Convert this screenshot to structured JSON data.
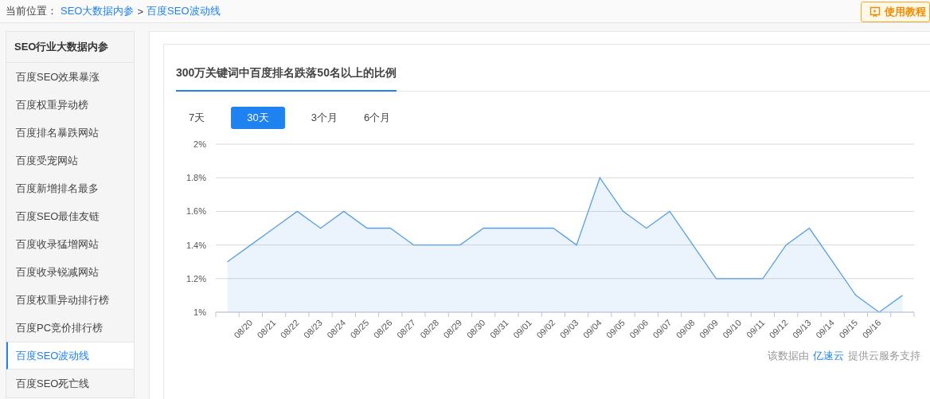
{
  "breadcrumb": {
    "label": "当前位置：",
    "links": [
      "SEO大数据内参",
      "百度SEO波动线"
    ],
    "separator": ">"
  },
  "help_button": {
    "label": "使用教程"
  },
  "sidebar": {
    "title": "SEO行业大数据内参",
    "items": [
      {
        "label": "百度SEO效果暴涨",
        "selected": false
      },
      {
        "label": "百度权重异动榜",
        "selected": false
      },
      {
        "label": "百度排名暴跌网站",
        "selected": false
      },
      {
        "label": "百度受宠网站",
        "selected": false
      },
      {
        "label": "百度新增排名最多",
        "selected": false
      },
      {
        "label": "百度SEO最佳友链",
        "selected": false
      },
      {
        "label": "百度收录猛增网站",
        "selected": false
      },
      {
        "label": "百度收录锐减网站",
        "selected": false
      },
      {
        "label": "百度权重异动排行榜",
        "selected": false
      },
      {
        "label": "百度PC竞价排行榜",
        "selected": false
      },
      {
        "label": "百度SEO波动线",
        "selected": true
      },
      {
        "label": "百度SEO死亡线",
        "selected": false
      }
    ]
  },
  "panel": {
    "title": "300万关键词中百度排名跌落50名以上的比例",
    "ranges": [
      {
        "label": "7天",
        "selected": false
      },
      {
        "label": "30天",
        "selected": true
      },
      {
        "label": "3个月",
        "selected": false
      },
      {
        "label": "6个月",
        "selected": false
      }
    ],
    "chart_data": {
      "type": "area",
      "categories": [
        null,
        "08/20",
        "08/21",
        "08/22",
        "08/23",
        "08/24",
        "08/25",
        "08/26",
        "08/27",
        "08/28",
        "08/29",
        "08/30",
        "08/31",
        "09/01",
        "09/02",
        "09/03",
        "09/04",
        "09/05",
        "09/06",
        "09/07",
        "09/08",
        "09/09",
        "09/10",
        "09/11",
        "09/12",
        "09/13",
        "09/14",
        "09/15",
        "09/16",
        null
      ],
      "series": [
        {
          "color": "#5a9fe6",
          "values": [
            1.3,
            1.4,
            1.5,
            1.6,
            1.5,
            1.6,
            1.5,
            1.5,
            1.4,
            1.4,
            1.4,
            1.5,
            1.5,
            1.5,
            1.5,
            1.4,
            1.8,
            1.6,
            1.5,
            1.6,
            1.4,
            1.2,
            1.2,
            1.2,
            1.4,
            1.5,
            1.3,
            1.1,
            1.0,
            1.1
          ]
        }
      ],
      "ylim": [
        1,
        2
      ],
      "grid": true,
      "yticks": [
        {
          "value": 1,
          "label": "1%"
        },
        {
          "value": 1.2,
          "label": "1.2%"
        },
        {
          "value": 1.4,
          "label": "1.4%"
        },
        {
          "value": 1.6,
          "label": "1.6%"
        },
        {
          "value": 1.8,
          "label": "1.8%"
        },
        {
          "value": 2,
          "label": "2%"
        }
      ]
    },
    "footer": {
      "before": "该数据由",
      "link": "亿速云",
      "after": "提供云服务支持"
    }
  }
}
